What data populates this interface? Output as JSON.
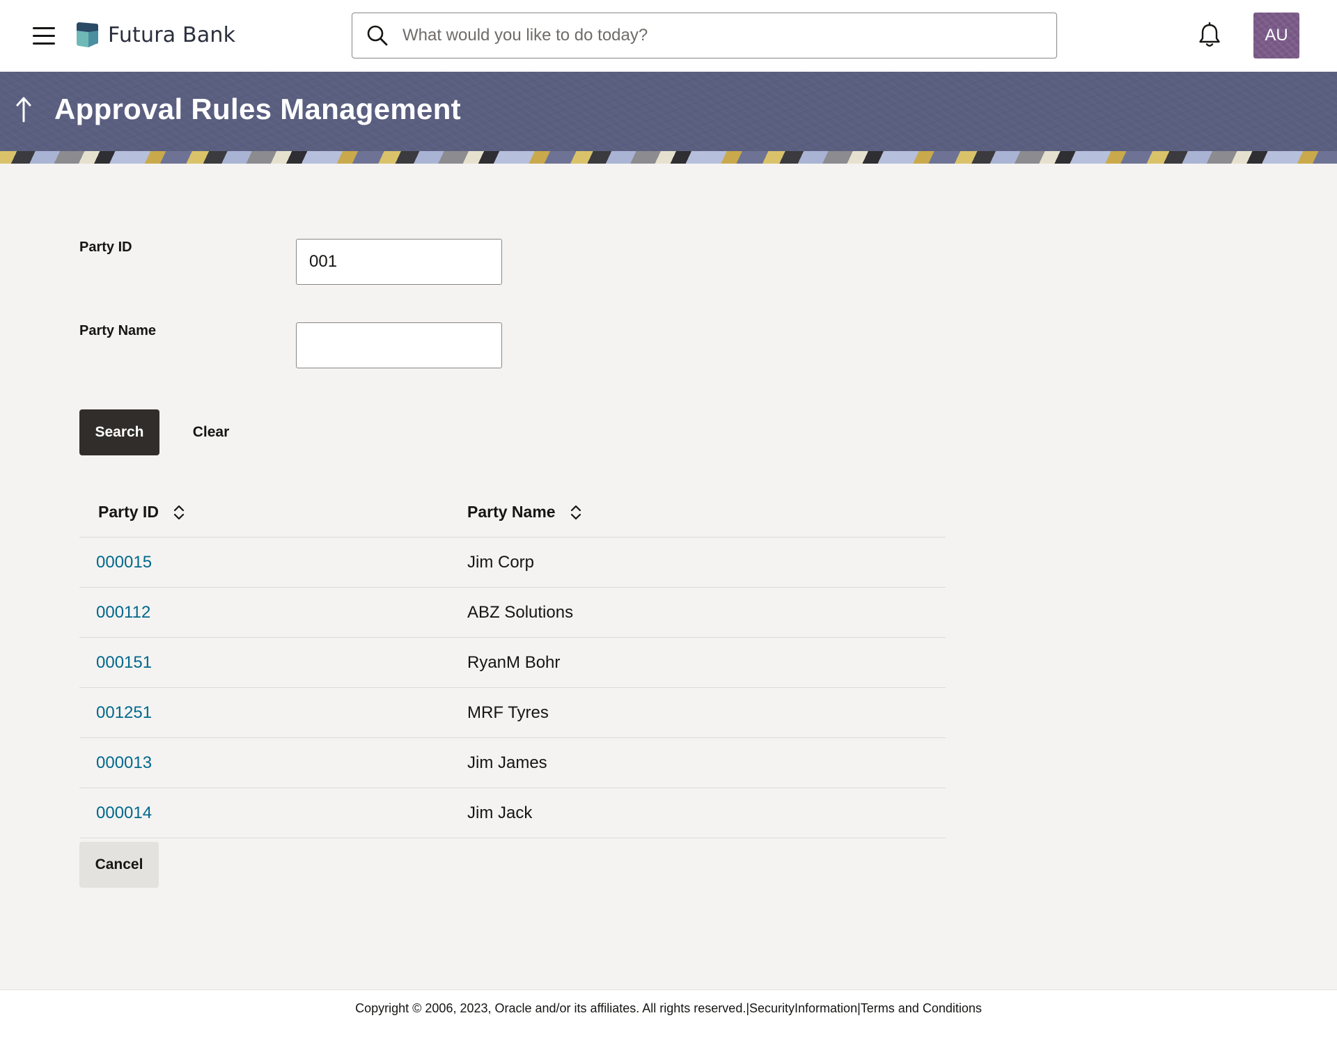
{
  "header": {
    "brand_name": "Futura Bank",
    "search_placeholder": "What would you like to do today?",
    "avatar_initials": "AU"
  },
  "page": {
    "title": "Approval Rules Management"
  },
  "form": {
    "party_id_label": "Party ID",
    "party_id_value": "001",
    "party_name_label": "Party Name",
    "party_name_value": "",
    "search_label": "Search",
    "clear_label": "Clear"
  },
  "table": {
    "columns": [
      "Party ID",
      "Party Name"
    ],
    "rows": [
      {
        "party_id": "000015",
        "party_name": "Jim Corp"
      },
      {
        "party_id": "000112",
        "party_name": "ABZ Solutions"
      },
      {
        "party_id": "000151",
        "party_name": "RyanM Bohr"
      },
      {
        "party_id": "001251",
        "party_name": "MRF Tyres"
      },
      {
        "party_id": "000013",
        "party_name": "Jim James"
      },
      {
        "party_id": "000014",
        "party_name": "Jim Jack"
      }
    ]
  },
  "actions": {
    "cancel_label": "Cancel"
  },
  "footer": {
    "copyright": "Copyright © 2006, 2023, Oracle and/or its affiliates. All rights reserved.",
    "separator": "|",
    "security_link": "SecurityInformation",
    "terms_link": "Terms and Conditions"
  },
  "colors": {
    "banner": "#5a5f80",
    "primary_button": "#312d2a",
    "link": "#00688c",
    "avatar": "#7a5a88"
  },
  "icons": {
    "menu": "hamburger-menu-icon",
    "search": "search-icon",
    "notifications": "bell-icon",
    "back": "arrow-up-icon",
    "sort": "sort-icon"
  }
}
